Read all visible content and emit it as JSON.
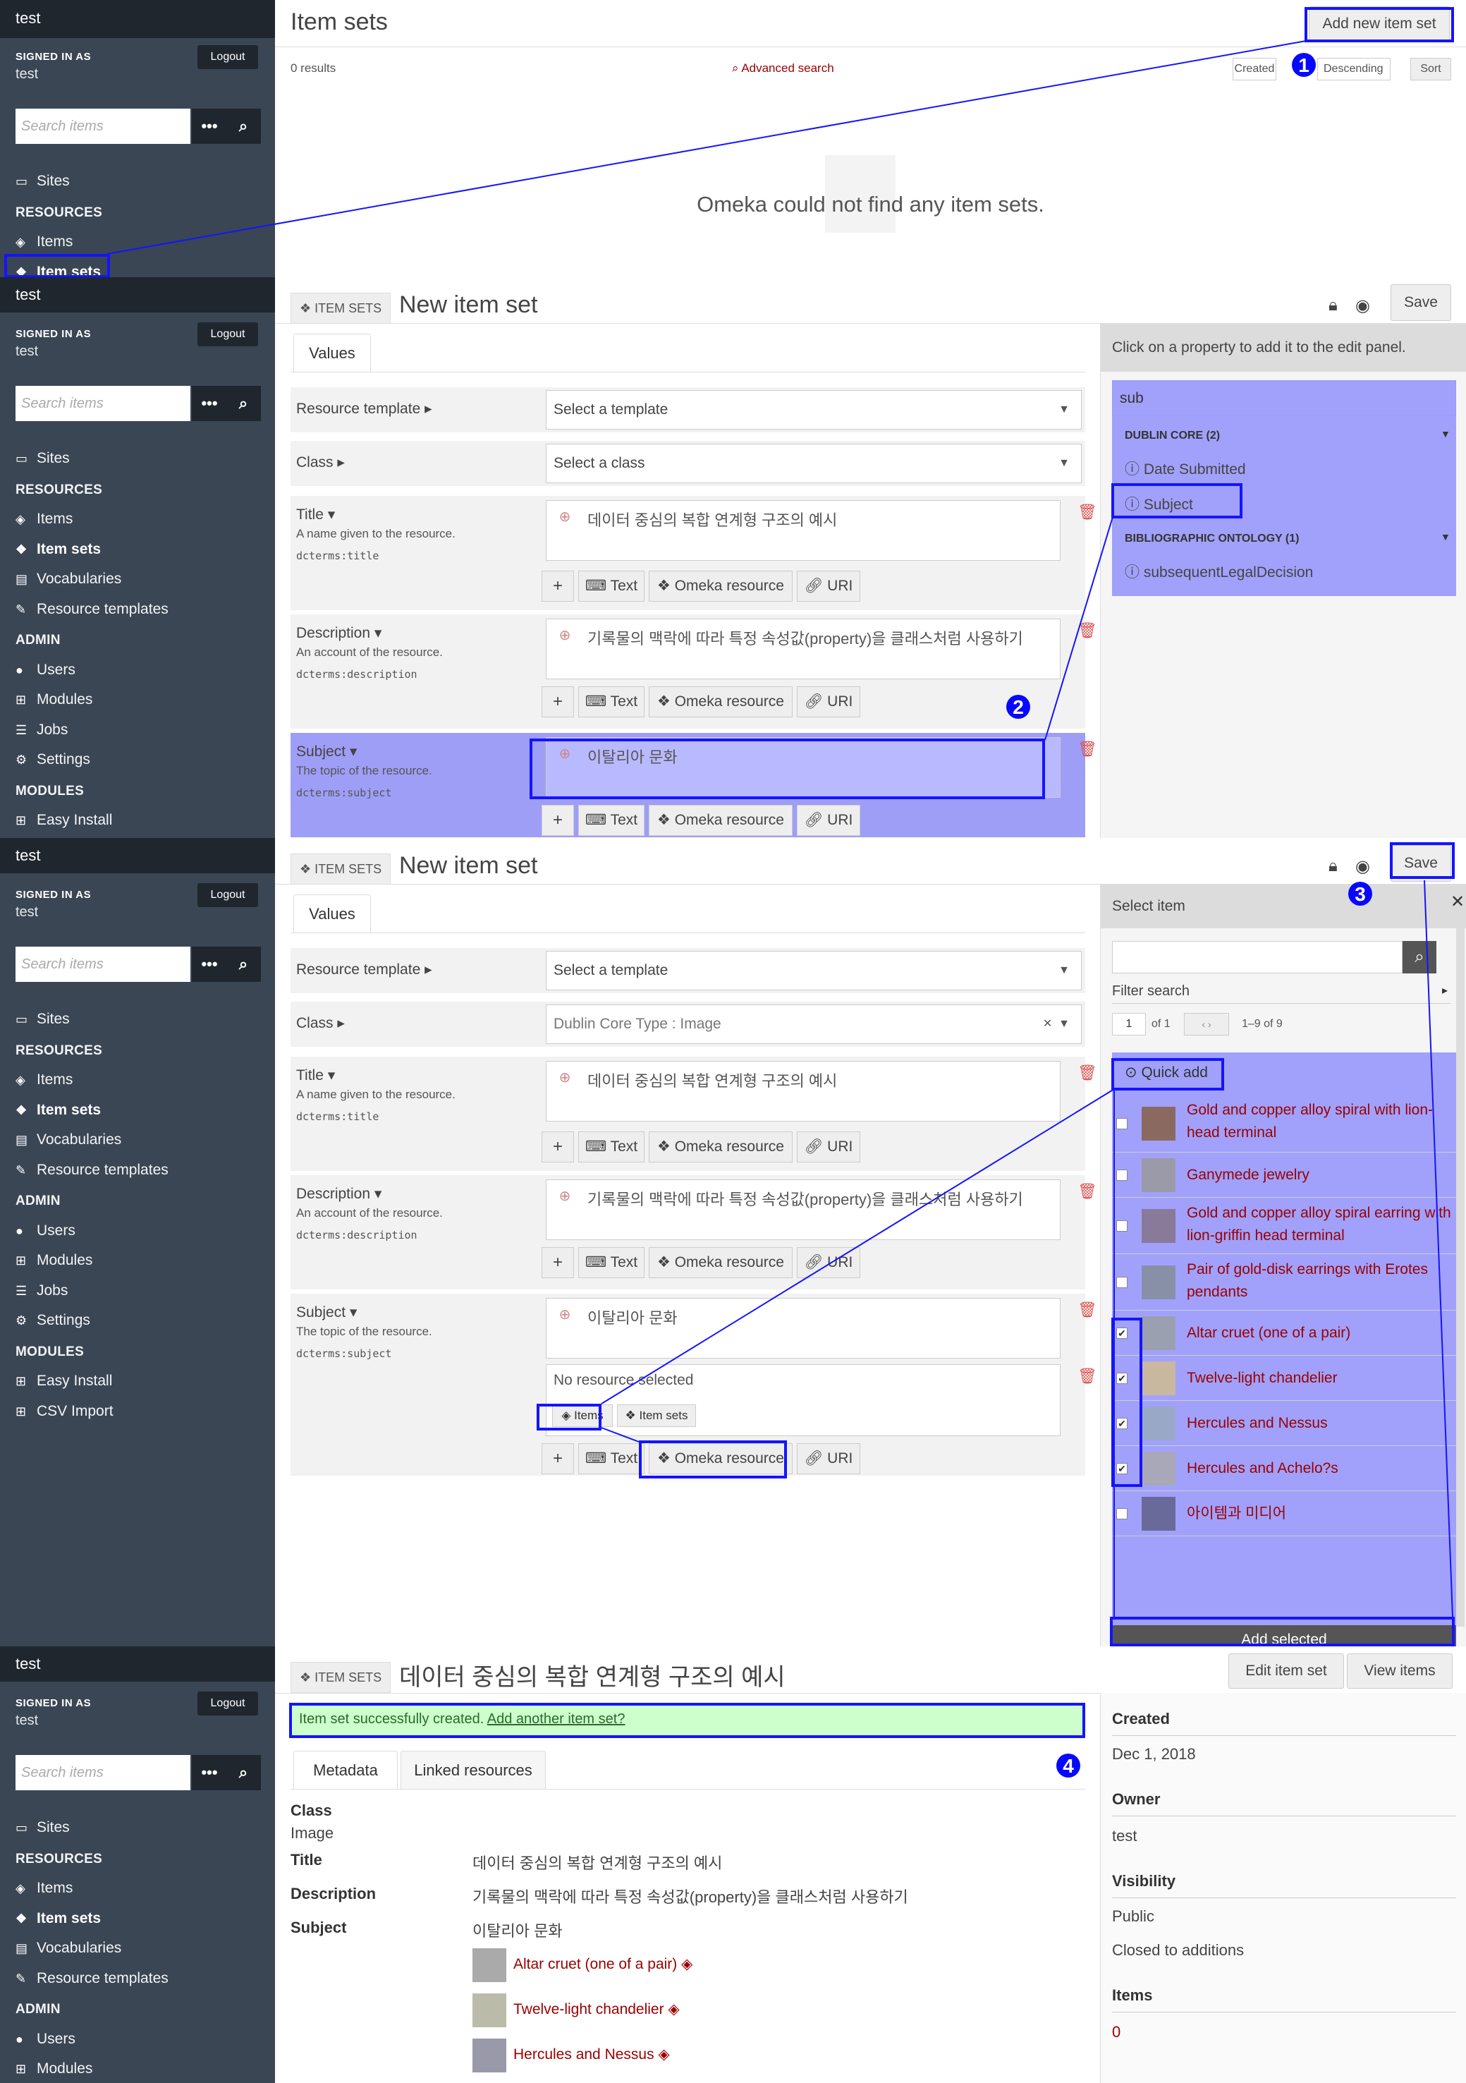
{
  "sidebar": {
    "brand": "test",
    "signed_in_as": "SIGNED IN AS",
    "user": "test",
    "logout": "Logout",
    "search_placeholder": "Search items",
    "sites": "Sites",
    "resources_head": "RESOURCES",
    "items": "Items",
    "item_sets": "Item sets",
    "vocabularies": "Vocabularies",
    "resource_templates": "Resource templates",
    "admin_head": "ADMIN",
    "users": "Users",
    "modules": "Modules",
    "jobs": "Jobs",
    "settings": "Settings",
    "modules_head": "MODULES",
    "easy_install": "Easy Install",
    "csv_import": "CSV Import"
  },
  "step1": {
    "title": "Item sets",
    "add_button": "Add new item set",
    "results": "0 results",
    "advanced_search": "Advanced search",
    "sort_by": "Created",
    "sort_order": "Descending",
    "sort_button": "Sort",
    "empty_message": "Omeka could not find any item sets."
  },
  "form": {
    "breadcrumb": "ITEM SETS",
    "title": "New item set",
    "save": "Save",
    "values_tab": "Values",
    "resource_template_label": "Resource template",
    "resource_template_value": "Select a template",
    "class_label": "Class",
    "class_value_empty": "Select a class",
    "class_value_selected": "Dublin Core Type : Image",
    "title_label": "Title",
    "title_desc": "A name given to the resource.",
    "title_term": "dcterms:title",
    "title_value": "데이터 중심의 복합 연계형 구조의 예시",
    "description_label": "Description",
    "description_desc": "An account of the resource.",
    "description_term": "dcterms:description",
    "description_value": "기록물의 맥락에 따라 특정 속성값(property)을 클래스처럼 사용하기",
    "subject_label": "Subject",
    "subject_desc": "The topic of the resource.",
    "subject_term": "dcterms:subject",
    "subject_value": "이탈리아 문화",
    "btn_text": "Text",
    "btn_omeka": "Omeka resource",
    "btn_uri": "URI",
    "no_resource": "No resource selected",
    "sub_items": "Items",
    "sub_item_sets": "Item sets"
  },
  "property_panel": {
    "heading": "Click on a property to add it to the edit panel.",
    "filter_value": "sub",
    "group1": "DUBLIN CORE (2)",
    "group1_props": [
      "Date Submitted",
      "Subject"
    ],
    "group2": "BIBLIOGRAPHIC ONTOLOGY (1)",
    "group2_props": [
      "subsequentLegalDecision"
    ]
  },
  "select_panel": {
    "heading": "Select item",
    "filter_search": "Filter search",
    "page": "1",
    "of": "of 1",
    "range": "1–9 of 9",
    "quick_add": "Quick add",
    "add_selected": "Add selected",
    "items": [
      {
        "name": "Gold and copper alloy spiral with lion-head terminal",
        "checked": false
      },
      {
        "name": "Ganymede jewelry",
        "checked": false
      },
      {
        "name": "Gold and copper alloy spiral earring with lion-griffin head terminal",
        "checked": false
      },
      {
        "name": "Pair of gold-disk earrings with Erotes pendants",
        "checked": false
      },
      {
        "name": "Altar cruet (one of a pair)",
        "checked": true
      },
      {
        "name": "Twelve-light chandelier",
        "checked": true
      },
      {
        "name": "Hercules and Nessus",
        "checked": true
      },
      {
        "name": "Hercules and Achelo?s",
        "checked": true
      },
      {
        "name": "아이템과 미디어",
        "checked": false
      }
    ]
  },
  "step4": {
    "breadcrumb": "ITEM SETS",
    "title": "데이터 중심의 복합 연계형 구조의 예시",
    "edit_button": "Edit item set",
    "view_button": "View items",
    "success": "Item set successfully created.",
    "add_another": "Add another item set?",
    "tab_metadata": "Metadata",
    "tab_linked": "Linked resources",
    "class_label": "Class",
    "class_value": "Image",
    "title_label": "Title",
    "title_value": "데이터 중심의 복합 연계형 구조의 예시",
    "description_label": "Description",
    "description_value": "기록물의 맥락에 따라 특정 속성값(property)을 클래스처럼 사용하기",
    "subject_label": "Subject",
    "subject_value": "이탈리아 문화",
    "linked": [
      "Altar cruet (one of a pair)",
      "Twelve-light chandelier",
      "Hercules and Nessus"
    ],
    "created_label": "Created",
    "created_value": "Dec 1, 2018",
    "owner_label": "Owner",
    "owner_value": "test",
    "visibility_label": "Visibility",
    "visibility_value": "Public",
    "closed": "Closed to additions",
    "items_label": "Items",
    "items_value": "0"
  },
  "annotations": [
    "1",
    "2",
    "3",
    "4"
  ],
  "colors": {
    "sidebar": "#3a4654",
    "sidebar_dark": "#1f262e",
    "accent_link": "#990000",
    "highlight": "#1414ff",
    "overlay": "#6e6eff",
    "success_bg": "#ccffcc"
  }
}
